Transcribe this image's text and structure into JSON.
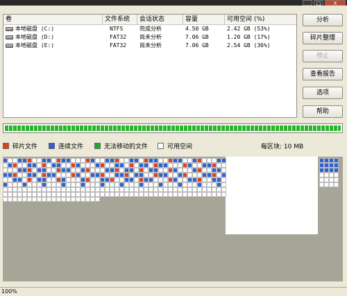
{
  "window": {
    "min_label": "_",
    "max_label": "□",
    "close_label": "X"
  },
  "volumes": {
    "columns": [
      "卷",
      "文件系统",
      "会话状态",
      "容量",
      "可用空间 (%)"
    ],
    "rows": [
      {
        "name": "本地磁盘 (C:)",
        "fs": "NTFS",
        "status": "完成分析",
        "capacity": "4.50 GB",
        "free": "2.42 GB (53%)"
      },
      {
        "name": "本地磁盘 (D:)",
        "fs": "FAT32",
        "status": "尚未分析",
        "capacity": "7.06 GB",
        "free": "1.20 GB (17%)"
      },
      {
        "name": "本地磁盘 (E:)",
        "fs": "FAT32",
        "status": "尚未分析",
        "capacity": "7.06 GB",
        "free": "2.54 GB (36%)"
      }
    ]
  },
  "buttons": {
    "analyze": "分析",
    "defrag": "碎片整理",
    "stop": "停止",
    "report": "查看报告",
    "options": "选项",
    "help": "帮助"
  },
  "progress": {
    "value": 1.0
  },
  "legend": {
    "fragmented": "碎片文件",
    "contiguous": "连续文件",
    "unmovable": "无法移动的文件",
    "free": "可用空间",
    "block_size": "每区块: 10 MB"
  },
  "colors": {
    "fragmented": "#e2401c",
    "contiguous": "#2a62d6",
    "unmovable": "#22a822",
    "free": "#ffffff",
    "unused": "#a6a597"
  },
  "status": {
    "zoom": "100%"
  }
}
